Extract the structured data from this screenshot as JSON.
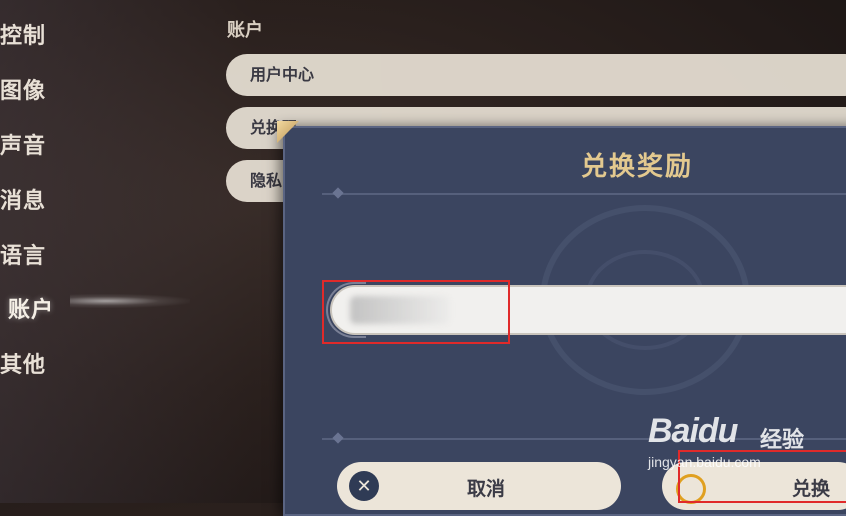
{
  "nav": {
    "items": [
      {
        "label": "控制",
        "active": false
      },
      {
        "label": "图像",
        "active": false
      },
      {
        "label": "声音",
        "active": false
      },
      {
        "label": "消息",
        "active": false
      },
      {
        "label": "语言",
        "active": false
      },
      {
        "label": "账户",
        "active": true
      },
      {
        "label": "其他",
        "active": false
      }
    ]
  },
  "account": {
    "title": "账户",
    "options": [
      "用户中心",
      "兑换码",
      "隐私"
    ]
  },
  "dialog": {
    "title": "兑换奖励",
    "input_value": "",
    "cancel_label": "取消",
    "confirm_label": "兑换",
    "cancel_icon": "close-x-icon",
    "confirm_icon": "circle-o-icon"
  },
  "colors": {
    "dialog_bg": "#3b4560",
    "title_gold": "#e3c98f",
    "button_bg": "#ece5d9",
    "highlight_red": "#e02a2a"
  },
  "watermark": {
    "logo": "Baidu",
    "cn": "经验",
    "url": "jingyan.baidu.com"
  }
}
